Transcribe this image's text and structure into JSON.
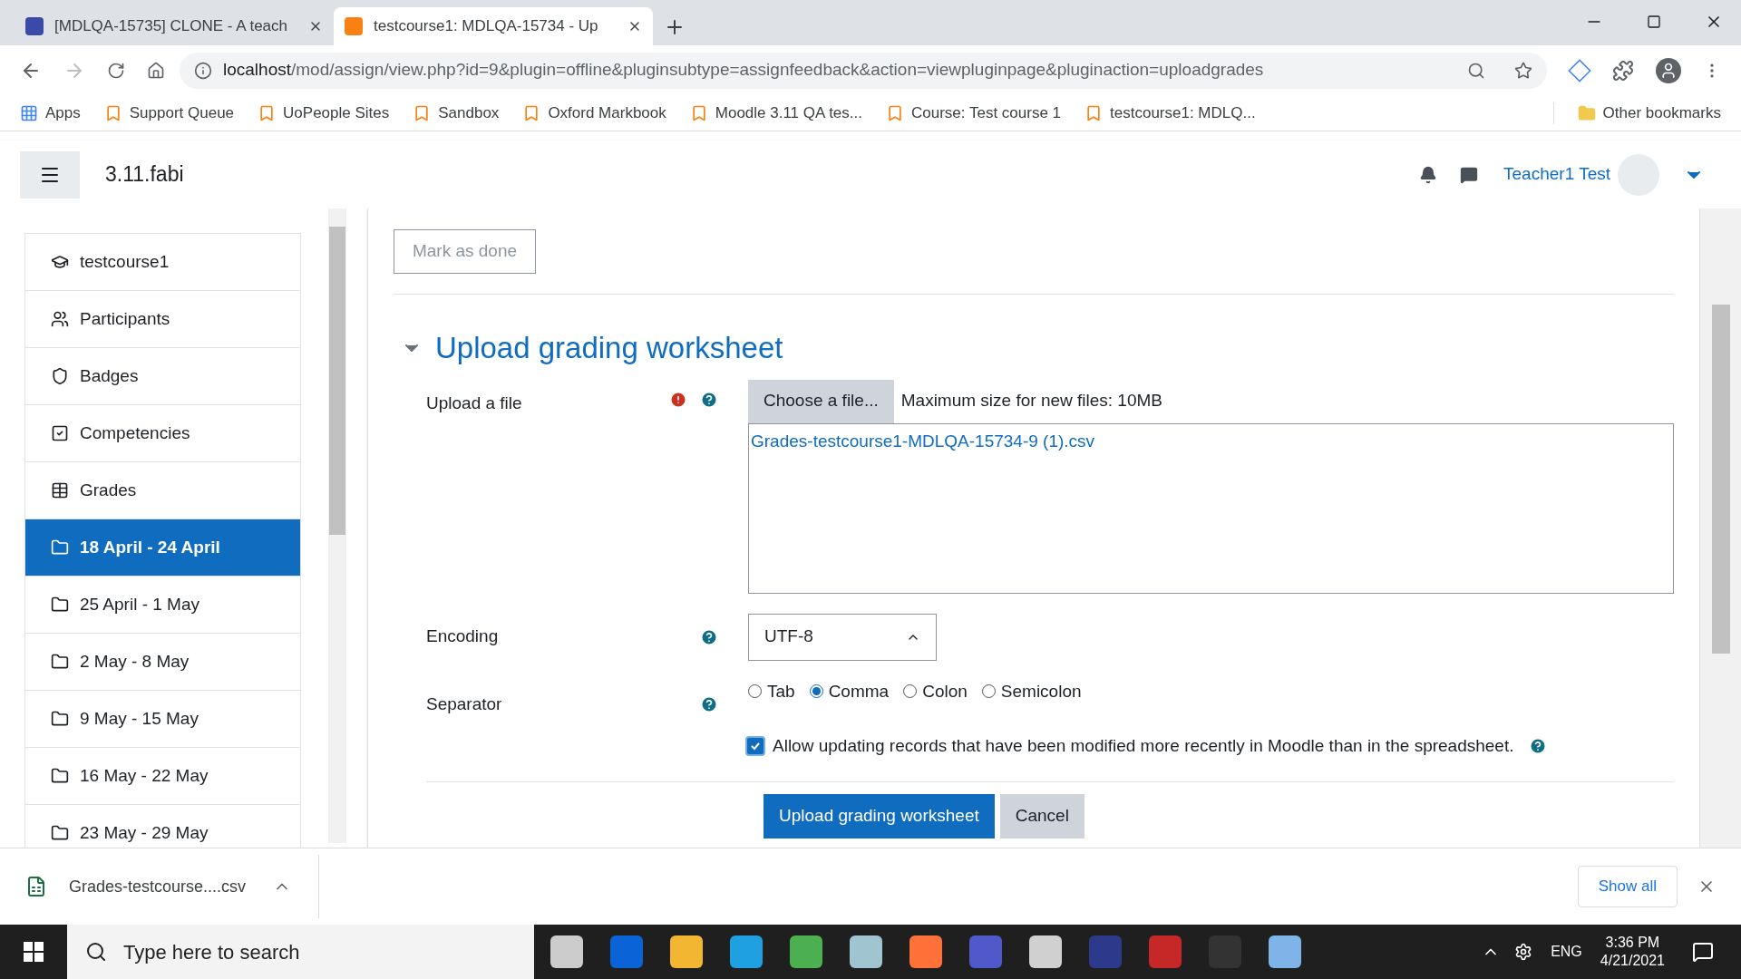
{
  "browser": {
    "tabs": [
      {
        "title": "[MDLQA-15735] CLONE - A teach",
        "selected": false
      },
      {
        "title": "testcourse1: MDLQA-15734 - Up",
        "selected": true
      }
    ],
    "url_host": "localhost",
    "url_path": "/mod/assign/view.php?id=9&plugin=offline&pluginsubtype=assignfeedback&action=viewpluginpage&pluginaction=uploadgrades",
    "bookmarks": [
      "Apps",
      "Support Queue",
      "UoPeople Sites",
      "Sandbox",
      "Oxford Markbook",
      "Moodle 3.11 QA tes...",
      "Course: Test course 1",
      "testcourse1: MDLQ..."
    ],
    "other_bookmarks": "Other bookmarks"
  },
  "header": {
    "site_name": "3.11.fabi",
    "user_name": "Teacher1 Test"
  },
  "sidebar": {
    "items": [
      {
        "label": "testcourse1",
        "kind": "course",
        "selected": false
      },
      {
        "label": "Participants",
        "kind": "participants",
        "selected": false
      },
      {
        "label": "Badges",
        "kind": "badges",
        "selected": false
      },
      {
        "label": "Competencies",
        "kind": "competencies",
        "selected": false
      },
      {
        "label": "Grades",
        "kind": "grades",
        "selected": false
      },
      {
        "label": "18 April - 24 April",
        "kind": "folder",
        "selected": true
      },
      {
        "label": "25 April - 1 May",
        "kind": "folder",
        "selected": false
      },
      {
        "label": "2 May - 8 May",
        "kind": "folder",
        "selected": false
      },
      {
        "label": "9 May - 15 May",
        "kind": "folder",
        "selected": false
      },
      {
        "label": "16 May - 22 May",
        "kind": "folder",
        "selected": false
      },
      {
        "label": "23 May - 29 May",
        "kind": "folder",
        "selected": false
      }
    ]
  },
  "content": {
    "mark_done": "Mark as done",
    "section_title": "Upload grading worksheet",
    "expanded": true,
    "upload_label": "Upload a file",
    "choose_button": "Choose a file...",
    "max_size": "Maximum size for new files: 10MB",
    "file_name": "Grades-testcourse1-MDLQA-15734-9 (1).csv",
    "encoding_label": "Encoding",
    "encoding_value": "UTF-8",
    "separator_label": "Separator",
    "separator_options": [
      {
        "label": "Tab",
        "selected": false
      },
      {
        "label": "Comma",
        "selected": true
      },
      {
        "label": "Colon",
        "selected": false
      },
      {
        "label": "Semicolon",
        "selected": false
      }
    ],
    "allow_update": {
      "label": "Allow updating records that have been modified more recently in Moodle than in the spreadsheet.",
      "checked": true
    },
    "submit_button": "Upload grading worksheet",
    "cancel_button": "Cancel"
  },
  "download_bar": {
    "file": "Grades-testcourse....csv",
    "show_all": "Show all"
  },
  "taskbar": {
    "search_placeholder": "Type here to search",
    "language": "ENG",
    "time": "3:36 PM",
    "date": "4/21/2021"
  }
}
